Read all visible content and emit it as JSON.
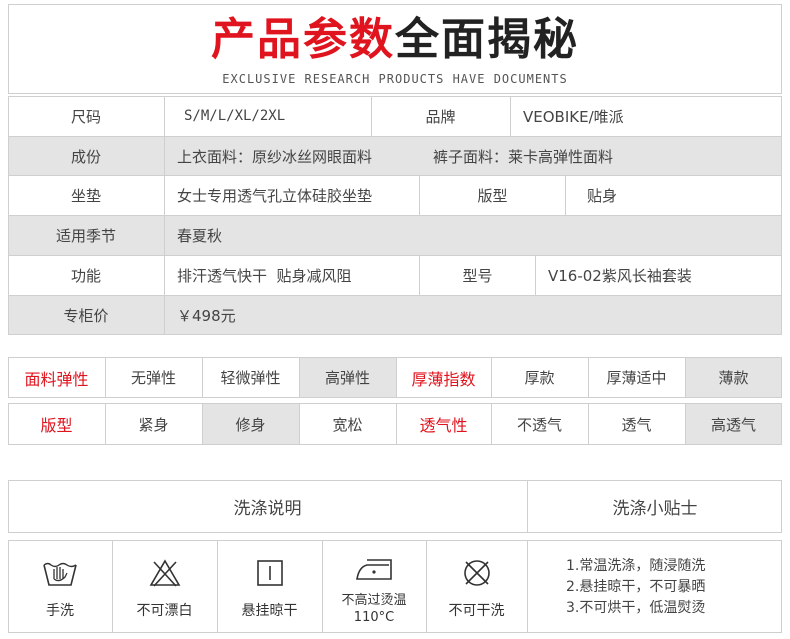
{
  "header": {
    "title_red": "产品参数",
    "title_black": "全面揭秘",
    "subtitle": "EXCLUSIVE RESEARCH PRODUCTS HAVE DOCUMENTS"
  },
  "params": {
    "size_label": "尺码",
    "size_value": "S/M/L/XL/2XL",
    "brand_label": "品牌",
    "brand_value": "VEOBIKE/唯派",
    "material_label": "成份",
    "material_top": "上衣面料：原纱冰丝网眼面料",
    "material_pants": "裤子面料：莱卡高弹性面料",
    "seat_label": "坐垫",
    "seat_value": "女士专用透气孔立体硅胶坐垫",
    "fit_label": "版型",
    "fit_value": "贴身",
    "season_label": "适用季节",
    "season_value": "春夏秋",
    "function_label": "功能",
    "function_value": "排汗透气快干  贴身减风阻",
    "model_label": "型号",
    "model_value": "V16-02紫风长袖套装",
    "price_label": "专柜价",
    "price_value": "￥498元"
  },
  "ratings": {
    "row1": {
      "elastic_label": "面料弹性",
      "elastic_options": [
        "无弹性",
        "轻微弹性",
        "高弹性"
      ],
      "elastic_selected": "高弹性",
      "thickness_label": "厚薄指数",
      "thickness_options": [
        "厚款",
        "厚薄适中",
        "薄款"
      ],
      "thickness_selected": "薄款"
    },
    "row2": {
      "fit_label": "版型",
      "fit_options": [
        "紧身",
        "修身",
        "宽松"
      ],
      "fit_selected": "修身",
      "breath_label": "透气性",
      "breath_options": [
        "不透气",
        "透气",
        "高透气"
      ],
      "breath_selected": "高透气"
    }
  },
  "wash": {
    "header": "洗涤说明",
    "tips_header": "洗涤小贴士",
    "icons": [
      {
        "icon": "hand-wash-icon",
        "label": "手洗"
      },
      {
        "icon": "no-bleach-icon",
        "label": "不可漂白"
      },
      {
        "icon": "hang-dry-icon",
        "label": "悬挂晾干"
      },
      {
        "icon": "iron-icon",
        "label": "不高过烫温",
        "label2": "110°C"
      },
      {
        "icon": "no-dry-clean-icon",
        "label": "不可干洗"
      }
    ],
    "tips": [
      "1.常温洗涤，随浸随洗",
      "2.悬挂晾干，不可暴晒",
      "3.不可烘干，低温熨烫"
    ]
  },
  "colors": {
    "accent": "#e0141e",
    "highlight_bg": "#e4e4e4",
    "border": "#cfcfcf"
  }
}
